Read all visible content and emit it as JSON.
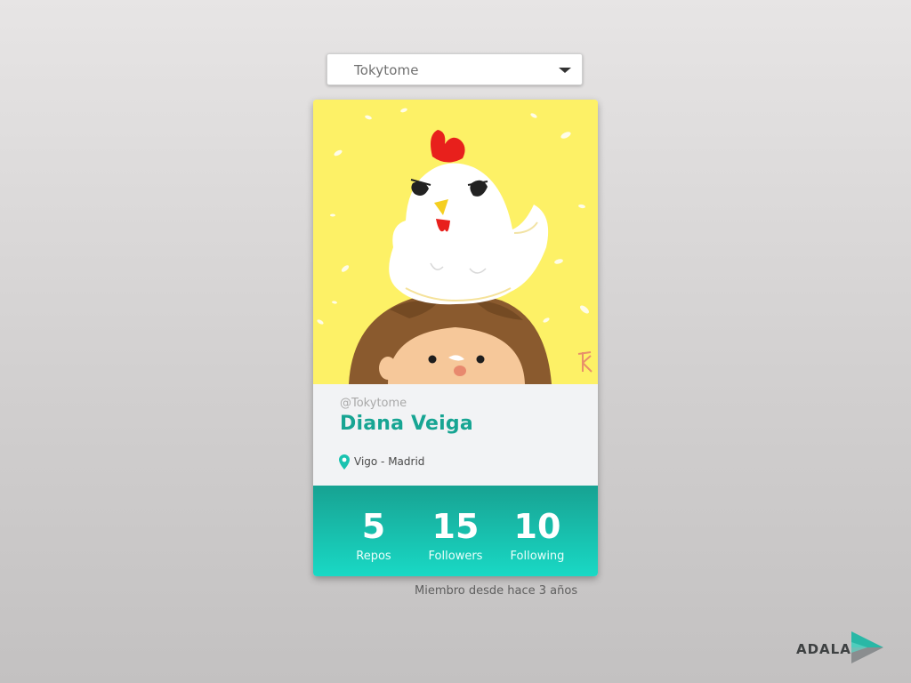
{
  "user_select": {
    "selected": "Tokytome",
    "icon": "chevron-down-icon"
  },
  "profile": {
    "avatar_icon": "avatar-illustration",
    "username": "@Tokytome",
    "name": "Diana Veiga",
    "location": "Vigo - Madrid",
    "location_icon": "map-pin-icon"
  },
  "stats": [
    {
      "value": "5",
      "label": "Repos"
    },
    {
      "value": "15",
      "label": "Followers"
    },
    {
      "value": "10",
      "label": "Following"
    }
  ],
  "member_since": "Miembro desde hace 3 años",
  "brand": {
    "name": "ADALAB"
  },
  "colors": {
    "accent": "#17a593",
    "stats_gradient_top": "#17a292",
    "stats_gradient_bottom": "#19d9c5",
    "avatar_background": "#fdf166"
  }
}
